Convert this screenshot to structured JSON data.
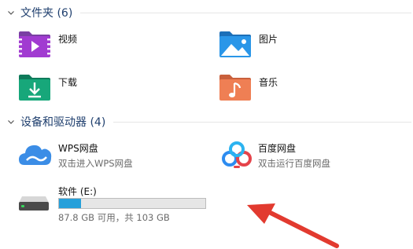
{
  "sections": {
    "folders": {
      "title": "文件夹 (6)"
    },
    "drives": {
      "title": "设备和驱动器 (4)"
    }
  },
  "folders": {
    "videos": {
      "label": "视频",
      "icon": "video-folder-icon"
    },
    "pictures": {
      "label": "图片",
      "icon": "pictures-folder-icon"
    },
    "downloads": {
      "label": "下载",
      "icon": "downloads-folder-icon"
    },
    "music": {
      "label": "音乐",
      "icon": "music-folder-icon"
    }
  },
  "drives": {
    "wps": {
      "label": "WPS网盘",
      "sub": "双击进入WPS网盘",
      "icon": "wps-cloud-icon"
    },
    "baidu": {
      "label": "百度网盘",
      "sub": "双击运行百度网盘",
      "icon": "baidu-netdisk-icon"
    },
    "e": {
      "label": "软件 (E:)",
      "sub": "87.8 GB 可用，共 103 GB",
      "icon": "hard-drive-icon",
      "used_fraction": 0.148
    }
  },
  "colors": {
    "accent": "#26a0da",
    "arrow": "#e23a2f",
    "section_text": "#1f3f6e"
  }
}
